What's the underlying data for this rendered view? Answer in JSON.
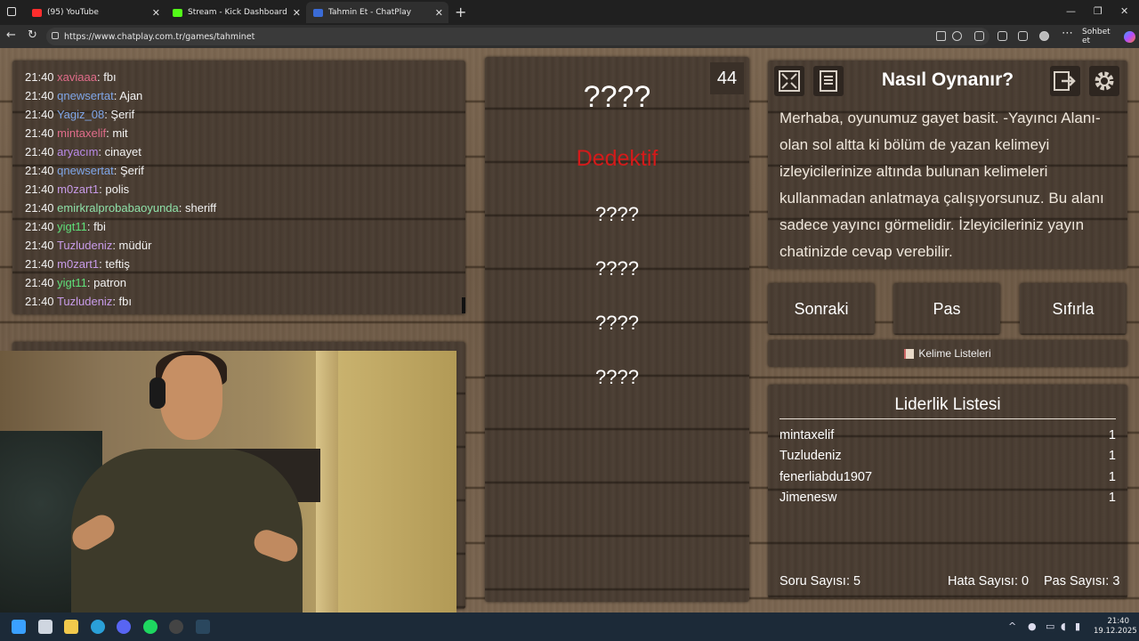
{
  "browser": {
    "tabs": [
      {
        "label": "(95) YouTube",
        "color": "#ff2d2d"
      },
      {
        "label": "Stream - Kick Dashboard",
        "color": "#53fc18"
      },
      {
        "label": "Tahmin Et - ChatPlay",
        "color": "#3a6bd6"
      }
    ],
    "url": "https://www.chatplay.com.tr/games/tahminet",
    "sohbet_label": "Sohbet et"
  },
  "chat": {
    "messages": [
      {
        "time": "21:40",
        "user": "xaviaaa",
        "text": ": fbı",
        "color": "#e06c8a"
      },
      {
        "time": "21:40",
        "user": "qnewsertat",
        "text": ": Ajan",
        "color": "#7fa6e8"
      },
      {
        "time": "21:40",
        "user": "Yagiz_08",
        "text": ": Şerif",
        "color": "#7fa6e8"
      },
      {
        "time": "21:40",
        "user": "mintaxelif",
        "text": ": mit",
        "color": "#e06c8a"
      },
      {
        "time": "21:40",
        "user": "aryacım",
        "text": ": cinayet",
        "color": "#b98ae8"
      },
      {
        "time": "21:40",
        "user": "qnewsertat",
        "text": ": Şerif",
        "color": "#7fa6e8"
      },
      {
        "time": "21:40",
        "user": "m0zart1",
        "text": ": polis",
        "color": "#c79be8"
      },
      {
        "time": "21:40",
        "user": "emirkralprobabaoyunda",
        "text": ": sheriff",
        "color": "#8ee0a8"
      },
      {
        "time": "21:40",
        "user": "yigt11",
        "text": ": fbi",
        "color": "#5fe07a"
      },
      {
        "time": "21:40",
        "user": "Tuzludeniz",
        "text": ": müdür",
        "color": "#c79be8"
      },
      {
        "time": "21:40",
        "user": "m0zart1",
        "text": ": teftiş",
        "color": "#c79be8"
      },
      {
        "time": "21:40",
        "user": "yigt11",
        "text": ": patron",
        "color": "#5fe07a"
      },
      {
        "time": "21:40",
        "user": "Tuzludeniz",
        "text": ": fbı",
        "color": "#c79be8"
      }
    ]
  },
  "game": {
    "timer": "44",
    "top_word": "????",
    "main_word": "Dedektif",
    "main_word_color": "#d41a1a",
    "forbidden_words": [
      "????",
      "????",
      "????",
      "????"
    ]
  },
  "howto": {
    "title": "Nasıl Oynanır?",
    "description": "Merhaba, oyunumuz gayet basit. -Yayıncı Alanı- olan sol altta ki bölüm de yazan kelimeyi izleyicilerinize altında bulunan kelimeleri kullanmadan anlatmaya çalışıyorsunuz. Bu alanı sadece yayıncı görmelidir. İzleyicileriniz yayın chatinizde cevap verebilir."
  },
  "buttons": {
    "next": "Sonraki",
    "pass": "Pas",
    "reset": "Sıfırla",
    "word_lists": "Kelime Listeleri"
  },
  "leaderboard": {
    "title": "Liderlik Listesi",
    "rows": [
      {
        "name": "mintaxelif",
        "score": "1"
      },
      {
        "name": "Tuzludeniz",
        "score": "1"
      },
      {
        "name": "fenerliabdu1907",
        "score": "1"
      },
      {
        "name": "Jimenesw",
        "score": "1"
      }
    ],
    "stats": {
      "questions": "Soru Sayısı: 5",
      "errors": "Hata Sayısı: 0",
      "passes": "Pas Sayısı: 3"
    }
  },
  "taskbar": {
    "time": "21:40",
    "date": "19.12.2025"
  }
}
